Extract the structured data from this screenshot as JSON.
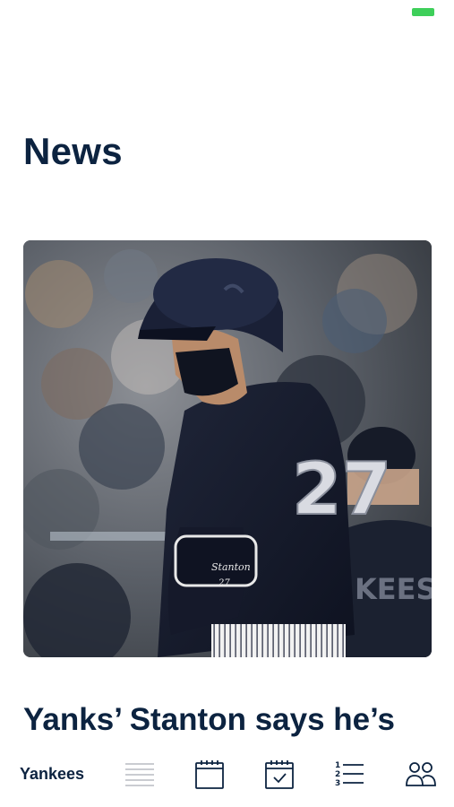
{
  "status_bar": {
    "battery_color": "#3ecf5a"
  },
  "page": {
    "title": "News"
  },
  "article": {
    "image_description_icon": "photo-baseball-player",
    "jersey_number": "27",
    "sleeve_name": "Stanton",
    "sleeve_number": "27",
    "headline": "Yanks’ Stanton says he’s"
  },
  "tab_bar": {
    "team_label": "Yankees",
    "tabs": [
      {
        "icon": "news-list-icon",
        "selected": true
      },
      {
        "icon": "calendar-icon",
        "selected": false
      },
      {
        "icon": "calendar-check-icon",
        "selected": false
      },
      {
        "icon": "standings-list-icon",
        "selected": false
      },
      {
        "icon": "roster-people-icon",
        "selected": false
      }
    ]
  },
  "colors": {
    "brand_navy": "#0c2340",
    "inactive_tab": "#b8bcc2",
    "battery_green": "#3ecf5a"
  }
}
